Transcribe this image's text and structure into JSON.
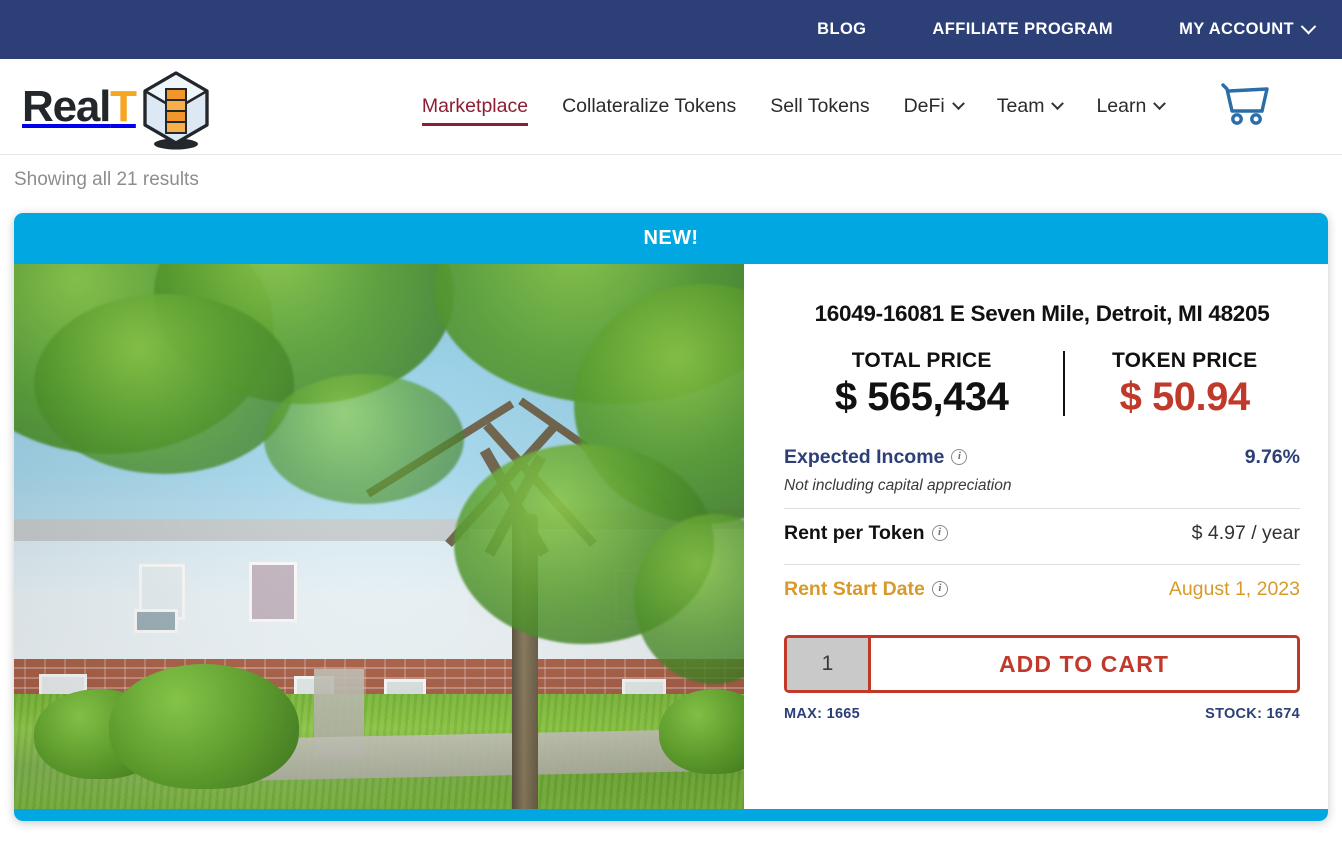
{
  "topbar": {
    "links": [
      {
        "label": "BLOG",
        "icon": null
      },
      {
        "label": "AFFILIATE PROGRAM",
        "icon": null
      },
      {
        "label": "MY ACCOUNT",
        "icon": "chevron-down-icon"
      }
    ]
  },
  "brand": {
    "name_part1": "Real",
    "name_part2": "T",
    "logo_icon": "realt-cube-logo"
  },
  "nav": {
    "items": [
      {
        "label": "Marketplace",
        "active": true,
        "caret": false
      },
      {
        "label": "Collateralize Tokens",
        "active": false,
        "caret": false
      },
      {
        "label": "Sell Tokens",
        "active": false,
        "caret": false
      },
      {
        "label": "DeFi",
        "active": false,
        "caret": true
      },
      {
        "label": "Team",
        "active": false,
        "caret": true
      },
      {
        "label": "Learn",
        "active": false,
        "caret": true
      }
    ],
    "cart_icon": "shopping-cart-icon"
  },
  "results": {
    "text": "Showing all 21 results"
  },
  "card": {
    "ribbon": "NEW!",
    "address": "16049-16081 E Seven Mile, Detroit, MI 48205",
    "photo_alt": "Two-story duplex homes with large tree and front lawn",
    "total_price_label": "TOTAL PRICE",
    "total_price_value": "$ 565,434",
    "token_price_label": "TOKEN PRICE",
    "token_price_value": "$ 50.94",
    "rows": [
      {
        "label": "Expected Income",
        "value": "9.76%",
        "sub": "Not including capital appreciation",
        "info": "info-icon"
      },
      {
        "label": "Rent per Token",
        "value": "$ 4.97 / year",
        "sub": null,
        "info": "info-icon"
      },
      {
        "label": "Rent Start Date",
        "value": "August 1, 2023",
        "sub": null,
        "info": "info-icon"
      }
    ],
    "quantity": "1",
    "add_to_cart_label": "ADD TO CART",
    "max_label": "MAX: 1665",
    "stock_label": "STOCK: 1674"
  },
  "colors": {
    "navy": "#2c4077",
    "ribbon_blue": "#00a7e1",
    "accent_red": "#c0392b",
    "marketplace_maroon": "#8c1d33",
    "gold": "#d89a2a",
    "logo_orange": "#f5a623",
    "cart_blue": "#2a6da8"
  }
}
